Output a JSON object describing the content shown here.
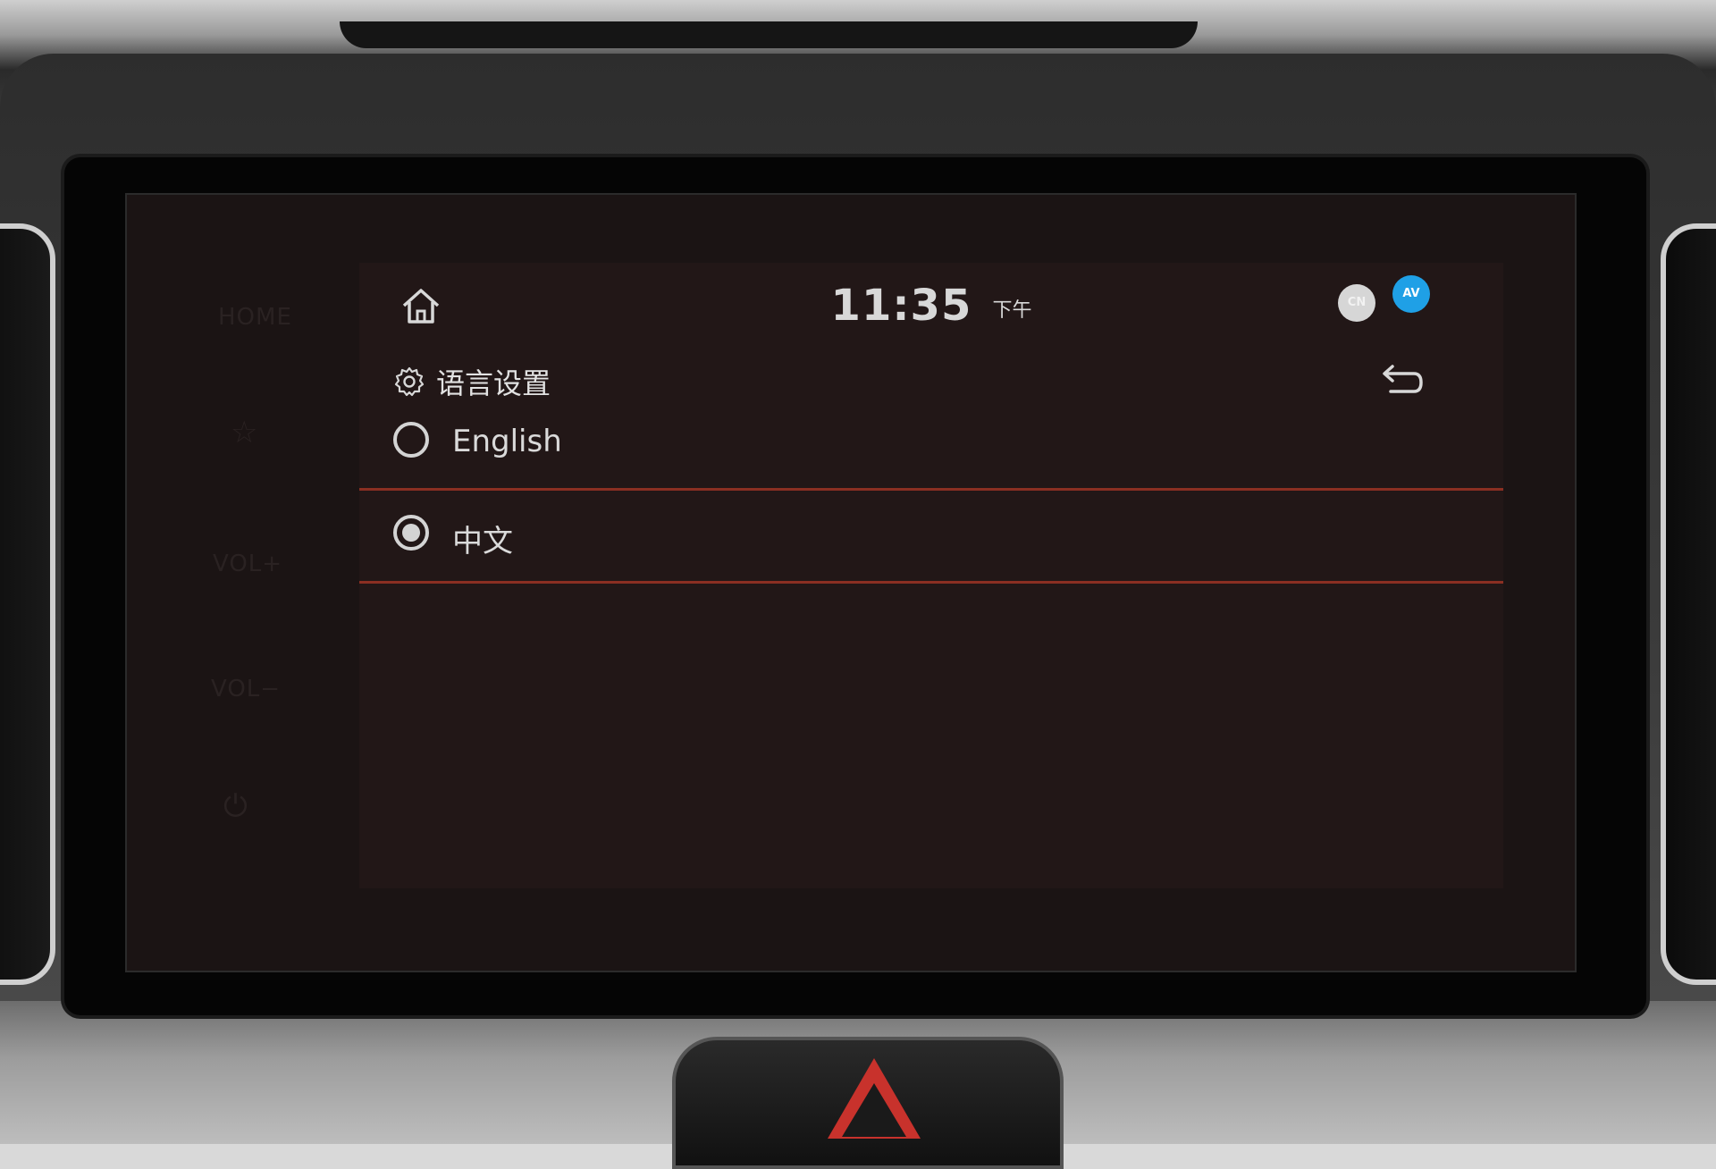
{
  "header": {
    "time": "11:35",
    "ampm": "下午",
    "badges": {
      "cn": "CN",
      "av": "AV"
    }
  },
  "page": {
    "title": "语言设置"
  },
  "options": [
    {
      "label": "English",
      "selected": false
    },
    {
      "label": "中文",
      "selected": true
    }
  ],
  "hardware": {
    "home_label": "HOME",
    "vol_up_label": "VOL+",
    "vol_down_label": "VOL−"
  },
  "colors": {
    "divider": "#8b2f22",
    "av_badge": "#1fa0e6",
    "background": "#221717"
  }
}
